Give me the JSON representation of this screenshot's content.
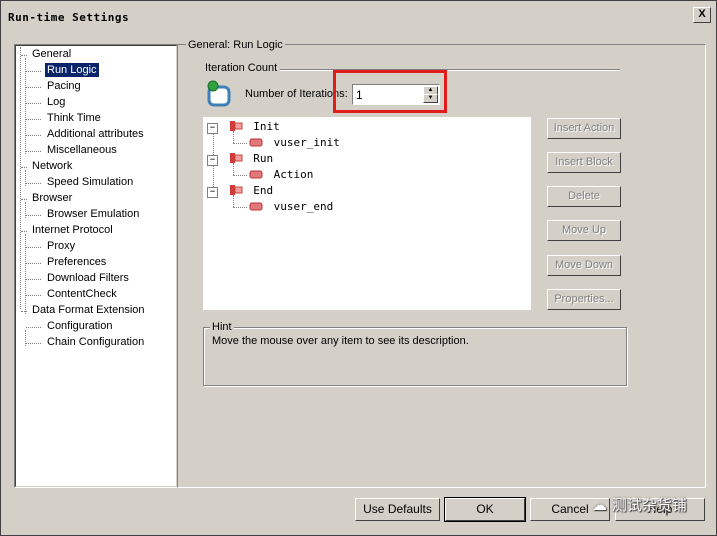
{
  "window": {
    "title": "Run-time Settings",
    "close": "X"
  },
  "tree": {
    "items": [
      {
        "label": "General",
        "level": 0
      },
      {
        "label": "Run Logic",
        "level": 1,
        "selected": true
      },
      {
        "label": "Pacing",
        "level": 1
      },
      {
        "label": "Log",
        "level": 1
      },
      {
        "label": "Think Time",
        "level": 1
      },
      {
        "label": "Additional attributes",
        "level": 1
      },
      {
        "label": "Miscellaneous",
        "level": 1
      },
      {
        "label": "Network",
        "level": 0
      },
      {
        "label": "Speed Simulation",
        "level": 1
      },
      {
        "label": "Browser",
        "level": 0
      },
      {
        "label": "Browser Emulation",
        "level": 1
      },
      {
        "label": "Internet Protocol",
        "level": 0
      },
      {
        "label": "Proxy",
        "level": 1
      },
      {
        "label": "Preferences",
        "level": 1
      },
      {
        "label": "Download Filters",
        "level": 1
      },
      {
        "label": "ContentCheck",
        "level": 1
      },
      {
        "label": "Data Format Extension",
        "level": 0
      },
      {
        "label": "Configuration",
        "level": 1
      },
      {
        "label": "Chain Configuration",
        "level": 1
      }
    ]
  },
  "panel": {
    "title": "General: Run Logic",
    "iteration_group": "Iteration Count",
    "iterations_label": "Number of Iterations:",
    "iterations_value": "1"
  },
  "logic_tree": {
    "nodes": [
      {
        "label": "Init",
        "type": "section"
      },
      {
        "label": "vuser_init",
        "type": "action"
      },
      {
        "label": "Run",
        "type": "section"
      },
      {
        "label": "Action",
        "type": "action"
      },
      {
        "label": "End",
        "type": "section"
      },
      {
        "label": "vuser_end",
        "type": "action"
      }
    ]
  },
  "buttons": {
    "insert_action": "Insert Action",
    "insert_block": "Insert Block",
    "delete": "Delete",
    "move_up": "Move Up",
    "move_down": "Move Down",
    "properties": "Properties..."
  },
  "hint": {
    "label": "Hint",
    "text": "Move the mouse over any item to see its description."
  },
  "footer": {
    "use_defaults": "Use Defaults",
    "ok": "OK",
    "cancel": "Cancel",
    "help": "Help"
  },
  "watermark": "测试杂货铺",
  "colors": {
    "highlight": "#e01c1c",
    "selection": "#0a246a",
    "face": "#d4d0c8"
  }
}
